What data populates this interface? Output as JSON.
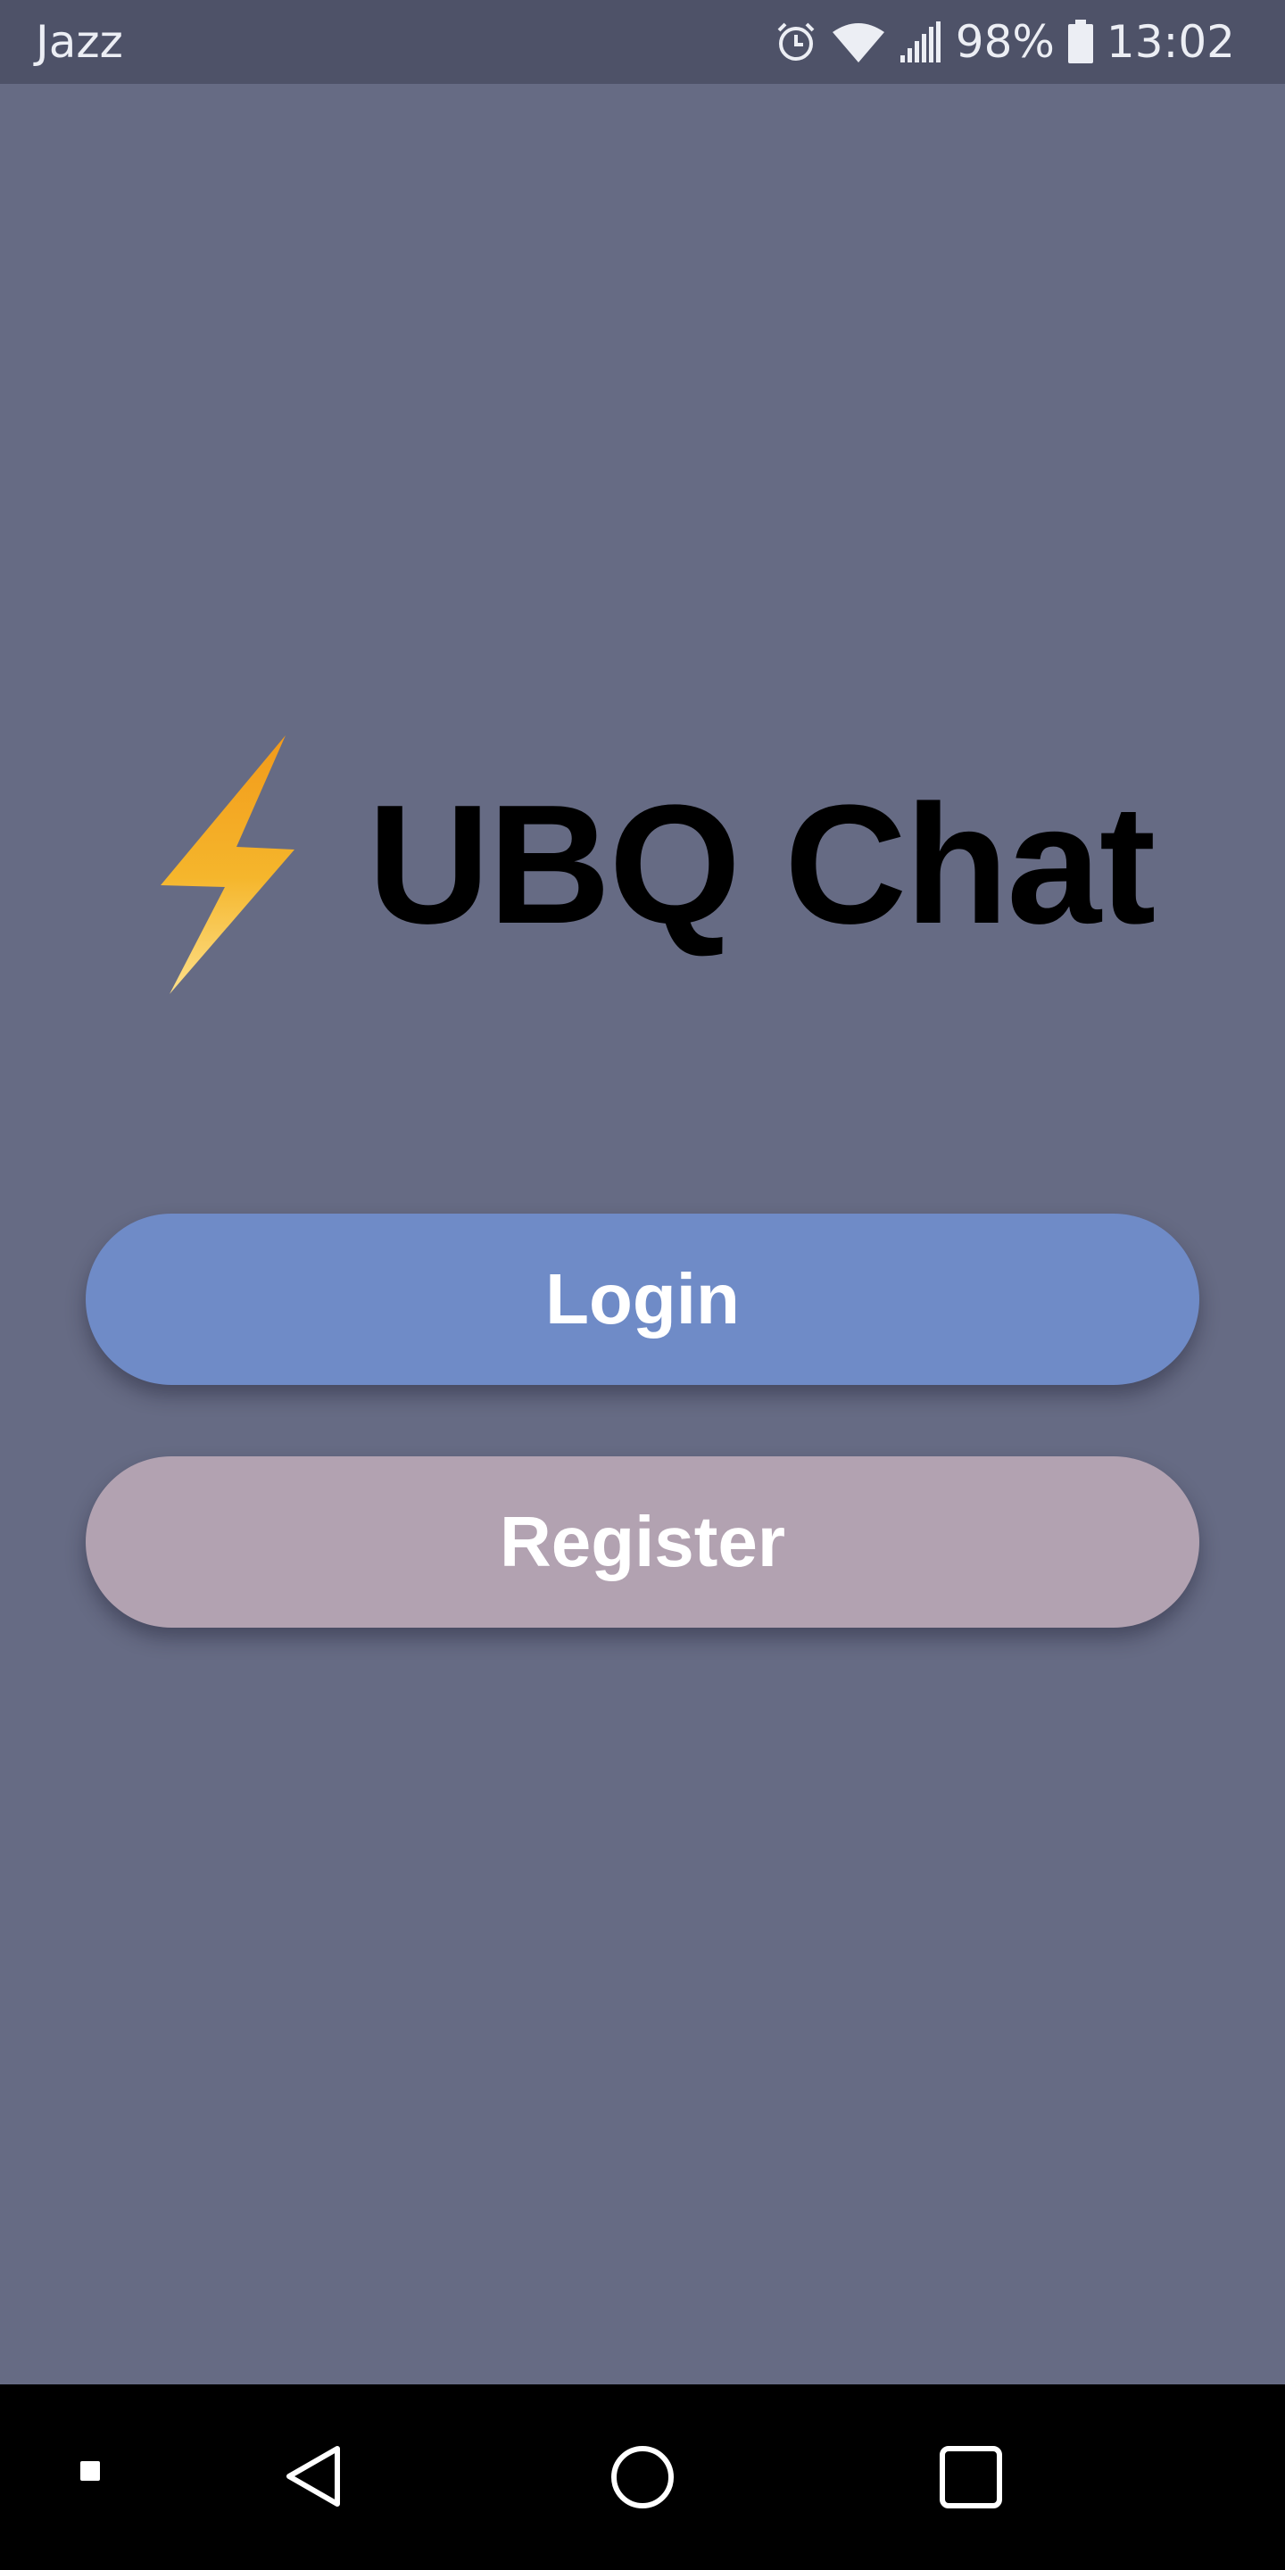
{
  "status_bar": {
    "carrier": "Jazz",
    "battery": "98%",
    "time": "13:02",
    "icons": [
      "alarm-icon",
      "wifi-icon",
      "signal-icon",
      "battery-icon"
    ]
  },
  "app": {
    "title": "UBQ Chat",
    "logo_icon": "lightning-bolt-icon"
  },
  "buttons": {
    "login_label": "Login",
    "register_label": "Register"
  },
  "nav_bar": {
    "items": [
      "square-dot-icon",
      "back-icon",
      "home-icon",
      "recents-icon"
    ]
  },
  "colors": {
    "background": "#666b84",
    "status_bar": "#4e5268",
    "login_button": "#6f8bc7",
    "register_button": "#b2a2b1",
    "logo_gradient_top": "#f4a020",
    "logo_gradient_bottom": "#fcd97a"
  }
}
